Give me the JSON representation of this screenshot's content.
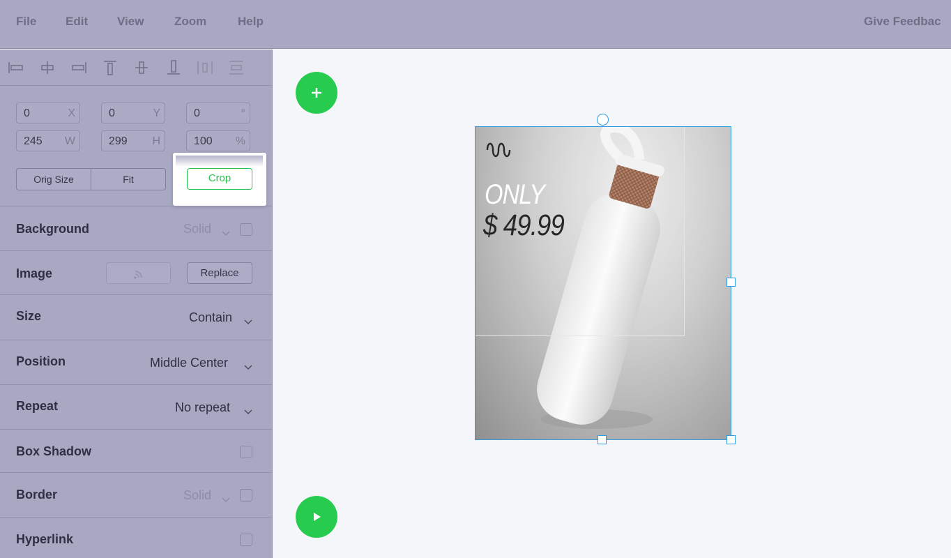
{
  "menu": {
    "items": [
      "File",
      "Edit",
      "View",
      "Zoom",
      "Help"
    ],
    "feedback": "Give Feedbac"
  },
  "transform": {
    "x": {
      "value": "0",
      "unit": "X"
    },
    "y": {
      "value": "0",
      "unit": "Y"
    },
    "rotation": {
      "value": "0",
      "unit": "°"
    },
    "w": {
      "value": "245",
      "unit": "W"
    },
    "h": {
      "value": "299",
      "unit": "H"
    },
    "scale": {
      "value": "100",
      "unit": "%"
    }
  },
  "buttons": {
    "orig_size": "Orig Size",
    "fit": "Fit",
    "crop": "Crop",
    "replace": "Replace"
  },
  "sections": {
    "background": {
      "title": "Background",
      "value": "Solid"
    },
    "image": {
      "title": "Image"
    },
    "size": {
      "title": "Size",
      "value": "Contain"
    },
    "position": {
      "title": "Position",
      "value": "Middle Center"
    },
    "repeat": {
      "title": "Repeat",
      "value": "No repeat"
    },
    "box_shadow": {
      "title": "Box Shadow"
    },
    "border": {
      "title": "Border",
      "value": "Solid"
    },
    "hyperlink": {
      "title": "Hyperlink"
    }
  },
  "artwork": {
    "line1": "ONLY",
    "line2": "$ 49.99"
  },
  "colors": {
    "accent_green": "#27cc4f",
    "selection_blue": "#2f9be0",
    "panel_bg": "#a9a8c3"
  }
}
